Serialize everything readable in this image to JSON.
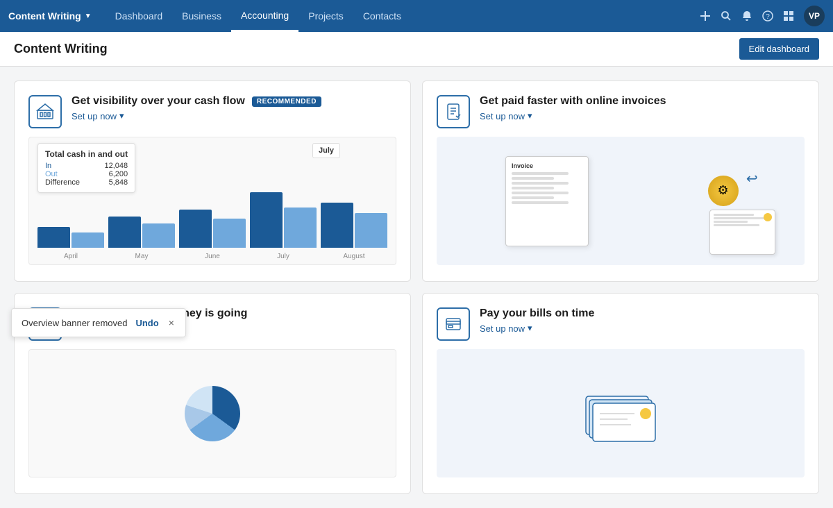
{
  "nav": {
    "brand": "Content Writing",
    "links": [
      {
        "label": "Dashboard",
        "active": false
      },
      {
        "label": "Business",
        "active": false
      },
      {
        "label": "Accounting",
        "active": true
      },
      {
        "label": "Projects",
        "active": false
      },
      {
        "label": "Contacts",
        "active": false
      }
    ],
    "avatar": "VP"
  },
  "subheader": {
    "title": "Content Writing",
    "edit_button": "Edit dashboard"
  },
  "cards": [
    {
      "id": "cash-flow",
      "title": "Get visibility over your cash flow",
      "badge": "Recommended",
      "setup_label": "Set up now",
      "has_badge": true
    },
    {
      "id": "online-invoices",
      "title": "Get paid faster with online invoices",
      "badge": null,
      "setup_label": "Set up now",
      "has_badge": false
    },
    {
      "id": "track-money",
      "title": "Track where your money is going",
      "badge": null,
      "setup_label": "Set up now",
      "has_badge": false
    },
    {
      "id": "pay-bills",
      "title": "Pay your bills on time",
      "badge": null,
      "setup_label": "Set up now",
      "has_badge": false
    }
  ],
  "chart": {
    "tooltip_label": "Total cash in and out",
    "popup_month": "July",
    "in_label": "In",
    "out_label": "Out",
    "diff_label": "Difference",
    "in_value": "12,048",
    "out_value": "6,200",
    "diff_value": "5,848",
    "months": [
      "April",
      "May",
      "June",
      "July",
      "August"
    ],
    "bars": [
      {
        "in": 30,
        "out": 22
      },
      {
        "in": 45,
        "out": 35
      },
      {
        "in": 55,
        "out": 42
      },
      {
        "in": 80,
        "out": 58
      },
      {
        "in": 65,
        "out": 50
      }
    ]
  },
  "toast": {
    "message": "Overview banner removed",
    "undo_label": "Undo",
    "close_label": "×"
  }
}
